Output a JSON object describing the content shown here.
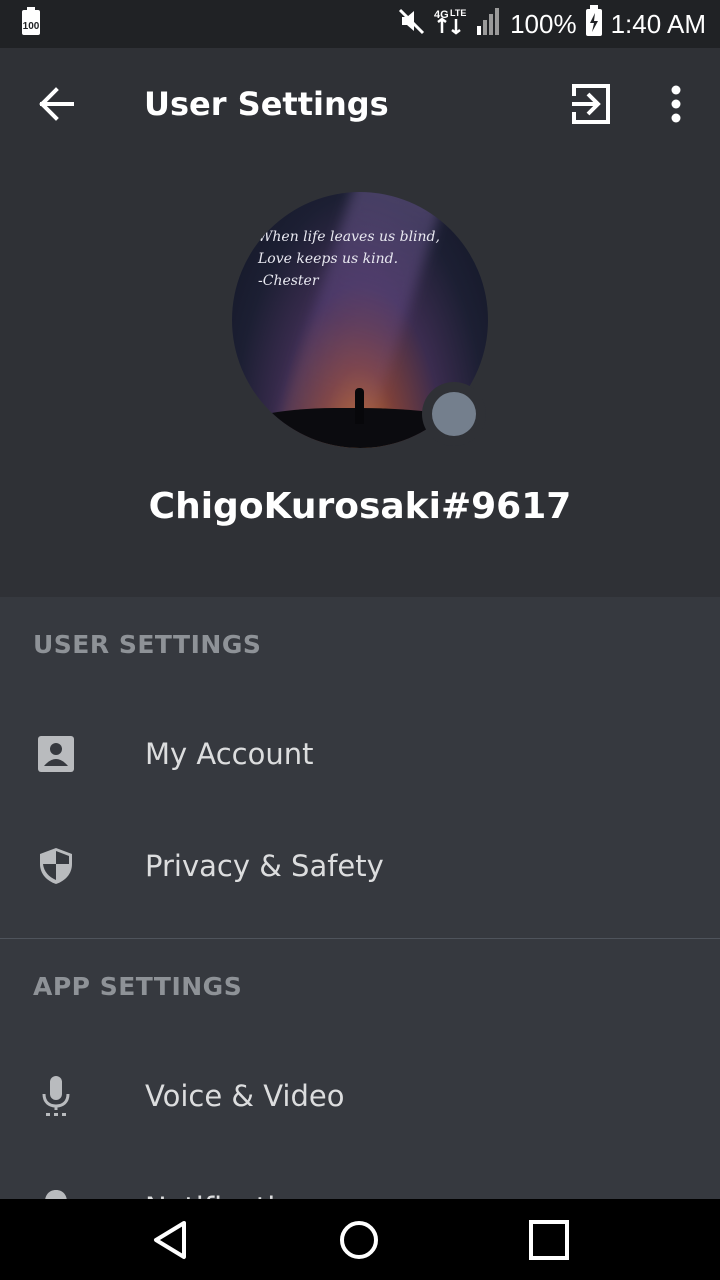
{
  "status_bar": {
    "left_icon": "battery-saver-100-icon",
    "icons": [
      "mute-icon",
      "network-4g-lte-icon",
      "signal-icon",
      "battery-charging-icon"
    ],
    "battery": "100%",
    "time": "1:40 AM"
  },
  "app_bar": {
    "title": "User Settings",
    "back_icon": "arrow-left-icon",
    "logout_icon": "logout-icon",
    "more_icon": "more-vertical-icon"
  },
  "profile": {
    "avatar_quote": "When life leaves us blind,\nLove keeps us kind.\n-Chester",
    "username": "ChigoKurosaki#9617",
    "status_color": "#747f8d"
  },
  "sections": {
    "user_settings": {
      "header": "USER SETTINGS",
      "items": [
        {
          "label": "My Account",
          "icon": "account-icon"
        },
        {
          "label": "Privacy & Safety",
          "icon": "shield-icon"
        }
      ]
    },
    "app_settings": {
      "header": "APP SETTINGS",
      "items": [
        {
          "label": "Voice & Video",
          "icon": "microphone-icon"
        },
        {
          "label": "Notifications",
          "icon": "bell-icon"
        }
      ]
    }
  },
  "nav_bar": {
    "back": "nav-back-icon",
    "home": "nav-home-icon",
    "recents": "nav-recents-icon"
  },
  "colors": {
    "background": "#36393f",
    "header_background": "#2f3136",
    "status_bar": "#202225",
    "section_header": "#8e9297",
    "item_text": "#dcddde"
  }
}
